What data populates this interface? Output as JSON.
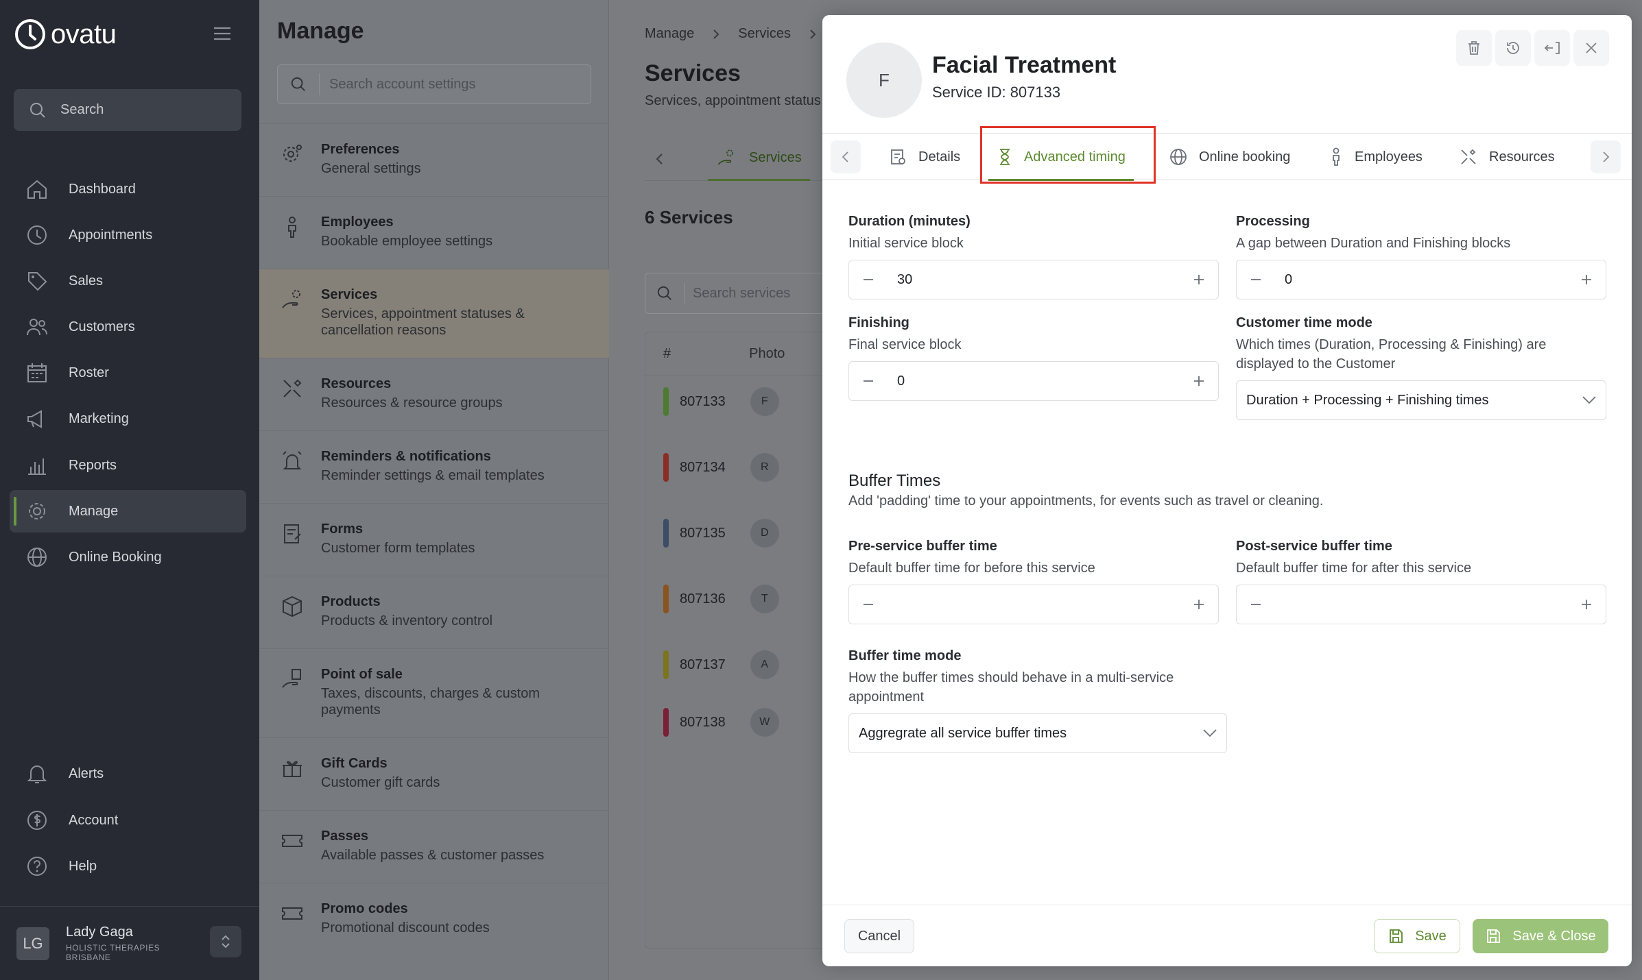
{
  "app": {
    "brand": "ovatu",
    "accent": "#5c8a2e"
  },
  "sidebar": {
    "search_label": "Search",
    "items": [
      {
        "label": "Dashboard",
        "icon": "home-icon"
      },
      {
        "label": "Appointments",
        "icon": "clock-icon"
      },
      {
        "label": "Sales",
        "icon": "tag-icon"
      },
      {
        "label": "Customers",
        "icon": "users-icon"
      },
      {
        "label": "Roster",
        "icon": "calendar-icon"
      },
      {
        "label": "Marketing",
        "icon": "megaphone-icon"
      },
      {
        "label": "Reports",
        "icon": "chart-icon"
      },
      {
        "label": "Manage",
        "icon": "gear-icon",
        "active": true
      },
      {
        "label": "Online Booking",
        "icon": "globe-icon"
      },
      {
        "label": "Alerts",
        "icon": "bell-icon"
      },
      {
        "label": "Account",
        "icon": "dollar-icon"
      },
      {
        "label": "Help",
        "icon": "help-icon"
      }
    ],
    "user": {
      "initials": "LG",
      "name": "Lady Gaga",
      "org": "HOLISTIC THERAPIES BRISBANE"
    }
  },
  "manage": {
    "title": "Manage",
    "search_placeholder": "Search account settings",
    "items": [
      {
        "title": "Preferences",
        "desc": "General settings"
      },
      {
        "title": "Employees",
        "desc": "Bookable employee settings"
      },
      {
        "title": "Services",
        "desc": "Services, appointment statuses & cancellation reasons",
        "active": true
      },
      {
        "title": "Resources",
        "desc": "Resources & resource groups"
      },
      {
        "title": "Reminders & notifications",
        "desc": "Reminder settings & email templates"
      },
      {
        "title": "Forms",
        "desc": "Customer form templates"
      },
      {
        "title": "Products",
        "desc": "Products & inventory control"
      },
      {
        "title": "Point of sale",
        "desc": "Taxes, discounts, charges & custom payments"
      },
      {
        "title": "Gift Cards",
        "desc": "Customer gift cards"
      },
      {
        "title": "Passes",
        "desc": "Available passes & customer passes"
      },
      {
        "title": "Promo codes",
        "desc": "Promotional discount codes"
      }
    ]
  },
  "services_page": {
    "breadcrumb": [
      "Manage",
      "Services"
    ],
    "title": "Services",
    "subtitle": "Services, appointment status",
    "tab": "Services",
    "count": "6 Services",
    "search_placeholder": "Search services",
    "columns": [
      "#",
      "Photo"
    ],
    "rows": [
      {
        "id": "807133",
        "initial": "F",
        "color": "#4e7a32"
      },
      {
        "id": "807134",
        "initial": "R",
        "color": "#8a2f25"
      },
      {
        "id": "807135",
        "initial": "D",
        "color": "#3c4d66"
      },
      {
        "id": "807136",
        "initial": "T",
        "color": "#8a5420"
      },
      {
        "id": "807137",
        "initial": "A",
        "color": "#7c7420"
      },
      {
        "id": "807138",
        "initial": "W",
        "color": "#7a2035"
      }
    ]
  },
  "modal": {
    "avatar": "F",
    "title": "Facial Treatment",
    "subtitle": "Service ID: 807133",
    "tabs": [
      "Details",
      "Advanced timing",
      "Online booking",
      "Employees",
      "Resources"
    ],
    "active_tab": "Advanced timing",
    "duration": {
      "label": "Duration (minutes)",
      "help": "Initial service block",
      "value": "30"
    },
    "processing": {
      "label": "Processing",
      "help": "A gap between Duration and Finishing blocks",
      "value": "0"
    },
    "finishing": {
      "label": "Finishing",
      "help": "Final service block",
      "value": "0"
    },
    "customer_time_mode": {
      "label": "Customer time mode",
      "help": "Which times (Duration, Processing & Finishing) are displayed to the Customer",
      "value": "Duration + Processing + Finishing times"
    },
    "buffer": {
      "title": "Buffer Times",
      "desc": "Add 'padding' time to your appointments, for events such as travel or cleaning.",
      "pre": {
        "label": "Pre-service buffer time",
        "help": "Default buffer time for before this service",
        "value": ""
      },
      "post": {
        "label": "Post-service buffer time",
        "help": "Default buffer time for after this service",
        "value": ""
      },
      "mode": {
        "label": "Buffer time mode",
        "help": "How the buffer times should behave in a multi-service appointment",
        "value": "Aggregrate all service buffer times"
      }
    },
    "footer": {
      "cancel": "Cancel",
      "save": "Save",
      "save_close": "Save & Close"
    }
  }
}
